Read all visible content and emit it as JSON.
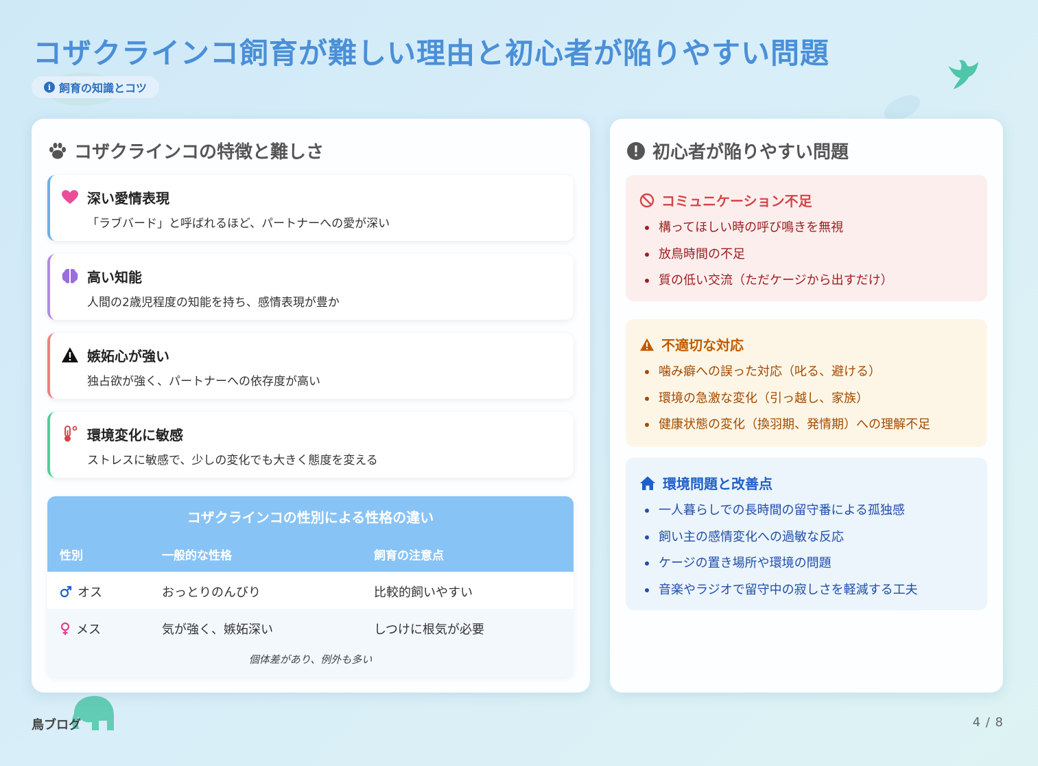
{
  "title": "コザクラインコ飼育が難しい理由と初心者が陥りやすい問題",
  "tag": {
    "label": "飼育の知識とコツ",
    "icon": "info-icon"
  },
  "left": {
    "heading": "コザクラインコの特徴と難しさ",
    "heading_icon": "paw-icon",
    "cards": [
      {
        "title": "深い愛情表現",
        "desc": "「ラブバード」と呼ばれるほど、パートナーへの愛が深い",
        "icon": "heart-icon",
        "color": "#6aaee8"
      },
      {
        "title": "高い知能",
        "desc": "人間の2歳児程度の知能を持ち、感情表現が豊か",
        "icon": "brain-icon",
        "color": "#b08ce8"
      },
      {
        "title": "嫉妬心が強い",
        "desc": "独占欲が強く、パートナーへの依存度が高い",
        "icon": "warning-icon",
        "color": "#ef7f7f"
      },
      {
        "title": "環境変化に敏感",
        "desc": "ストレスに敏感で、少しの変化でも大きく態度を変える",
        "icon": "thermometer-icon",
        "color": "#4fcf9a"
      }
    ],
    "table": {
      "title": "コザクラインコの性別による性格の違い",
      "headers": [
        "性別",
        "一般的な性格",
        "飼育の注意点"
      ],
      "rows": [
        {
          "sex": "オス",
          "personality": "おっとりのんびり",
          "care": "比較的飼いやすい",
          "icon": "male-icon"
        },
        {
          "sex": "メス",
          "personality": "気が強く、嫉妬深い",
          "care": "しつけに根気が必要",
          "icon": "female-icon"
        }
      ],
      "note": "個体差があり、例外も多い"
    }
  },
  "right": {
    "heading": "初心者が陥りやすい問題",
    "heading_icon": "exclamation-circle-icon",
    "boxes": [
      {
        "title": "コミュニケーション不足",
        "icon": "ban-icon",
        "color": "#d64545",
        "text_color": "#9b2020",
        "bg": "#fdeeee",
        "items": [
          "構ってほしい時の呼び鳴きを無視",
          "放鳥時間の不足",
          "質の低い交流（ただケージから出すだけ）"
        ]
      },
      {
        "title": "不適切な対応",
        "icon": "warning-icon",
        "color": "#c35a00",
        "text_color": "#a44a00",
        "bg": "#fdf6e6",
        "items": [
          "噛み癖への誤った対応（叱る、避ける）",
          "環境の急激な変化（引っ越し、家族）",
          "健康状態の変化（換羽期、発情期）への理解不足"
        ]
      },
      {
        "title": "環境問題と改善点",
        "icon": "home-icon",
        "color": "#1f5fc8",
        "text_color": "#1f4fa8",
        "bg": "#ecf4fc",
        "items": [
          "一人暮らしでの長時間の留守番による孤独感",
          "飼い主の感情変化への過敏な反応",
          "ケージの置き場所や環境の問題",
          "音楽やラジオで留守中の寂しさを軽減する工夫"
        ]
      }
    ]
  },
  "footer": {
    "brand": "鳥ブログ",
    "page": "4 / 8"
  }
}
